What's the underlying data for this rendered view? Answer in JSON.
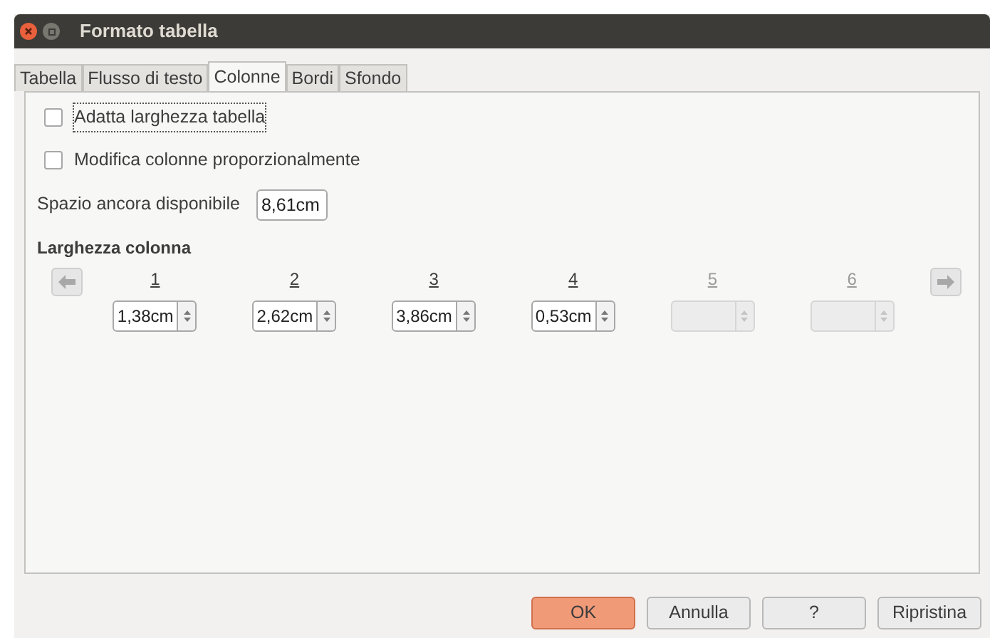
{
  "window": {
    "title": "Formato tabella"
  },
  "tabs": [
    {
      "label": "Tabella",
      "selected": false
    },
    {
      "label": "Flusso di testo",
      "selected": false
    },
    {
      "label": "Colonne",
      "selected": true
    },
    {
      "label": "Bordi",
      "selected": false
    },
    {
      "label": "Sfondo",
      "selected": false
    }
  ],
  "options": [
    {
      "label": "Adatta larghezza tabella",
      "checked": false,
      "focused": true
    },
    {
      "label": "Modifica colonne proporzionalmente",
      "checked": false,
      "focused": false
    }
  ],
  "remaining": {
    "label": "Spazio ancora disponibile",
    "value": "8,61cm"
  },
  "column_width": {
    "title": "Larghezza colonna",
    "columns": [
      {
        "label": "1",
        "value": "1,38cm",
        "disabled": false
      },
      {
        "label": "2",
        "value": "2,62cm",
        "disabled": false
      },
      {
        "label": "3",
        "value": "3,86cm",
        "disabled": false
      },
      {
        "label": "4",
        "value": "0,53cm",
        "disabled": false
      },
      {
        "label": "5",
        "disabled": true
      },
      {
        "label": "6",
        "disabled": true
      }
    ]
  },
  "buttons": [
    {
      "label": "OK",
      "kind": "default"
    },
    {
      "label": "Annulla",
      "kind": "normal"
    },
    {
      "label": "?",
      "kind": "normal"
    },
    {
      "label": "Ripristina",
      "kind": "normal"
    }
  ]
}
